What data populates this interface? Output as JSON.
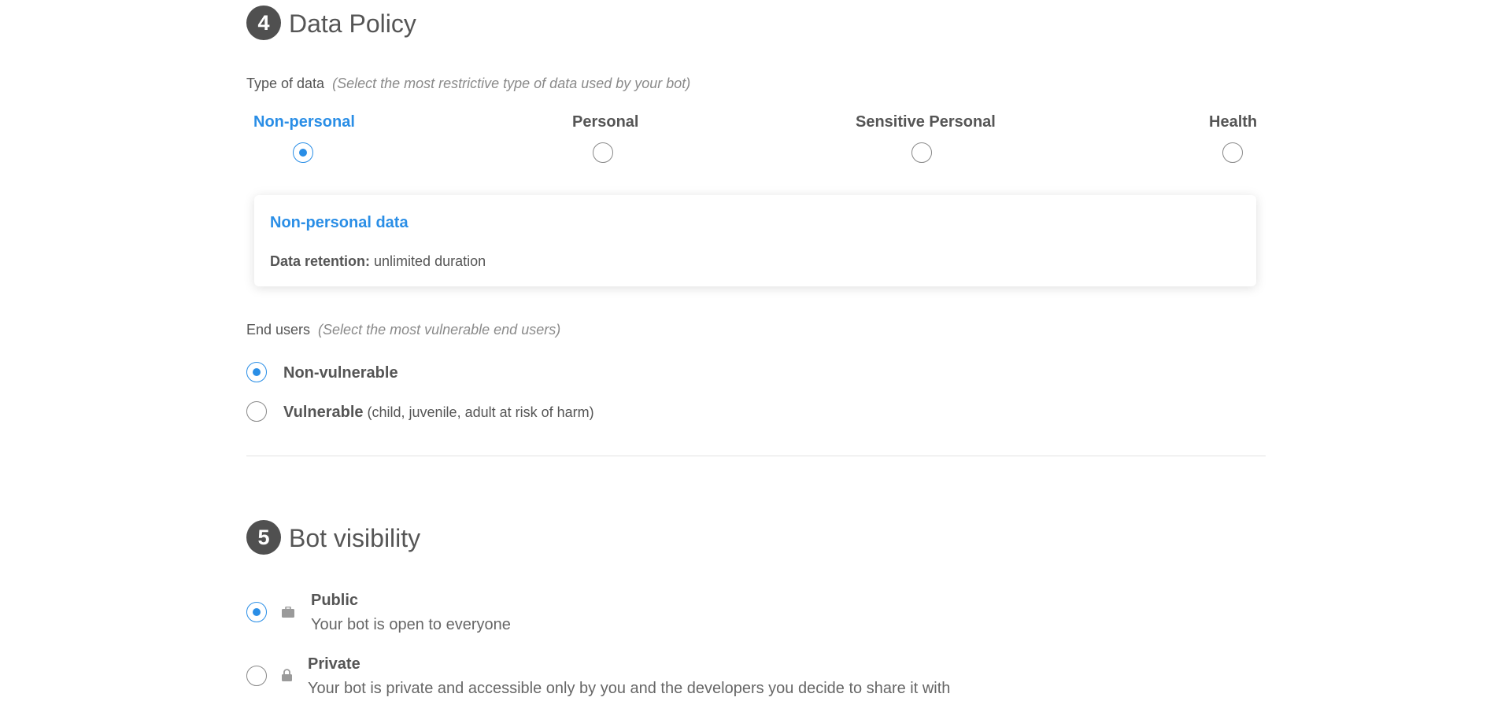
{
  "data_policy": {
    "step_number": "4",
    "title": "Data Policy",
    "type_of_data": {
      "label": "Type of data",
      "hint": "(Select the most restrictive type of data used by your bot)",
      "options": [
        {
          "label": "Non-personal",
          "selected": true
        },
        {
          "label": "Personal",
          "selected": false
        },
        {
          "label": "Sensitive Personal",
          "selected": false
        },
        {
          "label": "Health",
          "selected": false
        }
      ]
    },
    "info_card": {
      "title": "Non-personal data",
      "retention_label": "Data retention:",
      "retention_value": "unlimited duration"
    },
    "end_users": {
      "label": "End users",
      "hint": "(Select the most vulnerable end users)",
      "options": [
        {
          "label": "Non-vulnerable",
          "note": "",
          "selected": true
        },
        {
          "label": "Vulnerable",
          "note": "(child, juvenile, adult at risk of harm)",
          "selected": false
        }
      ]
    }
  },
  "bot_visibility": {
    "step_number": "5",
    "title": "Bot visibility",
    "options": [
      {
        "title": "Public",
        "description": "Your bot is open to everyone",
        "icon": "briefcase-icon",
        "selected": true
      },
      {
        "title": "Private",
        "description": "Your bot is private and accessible only by you and the developers you decide to share it with",
        "icon": "lock-icon",
        "selected": false
      }
    ]
  },
  "colors": {
    "accent": "#2a8ee6",
    "text": "#555555",
    "step_badge": "#505050"
  }
}
